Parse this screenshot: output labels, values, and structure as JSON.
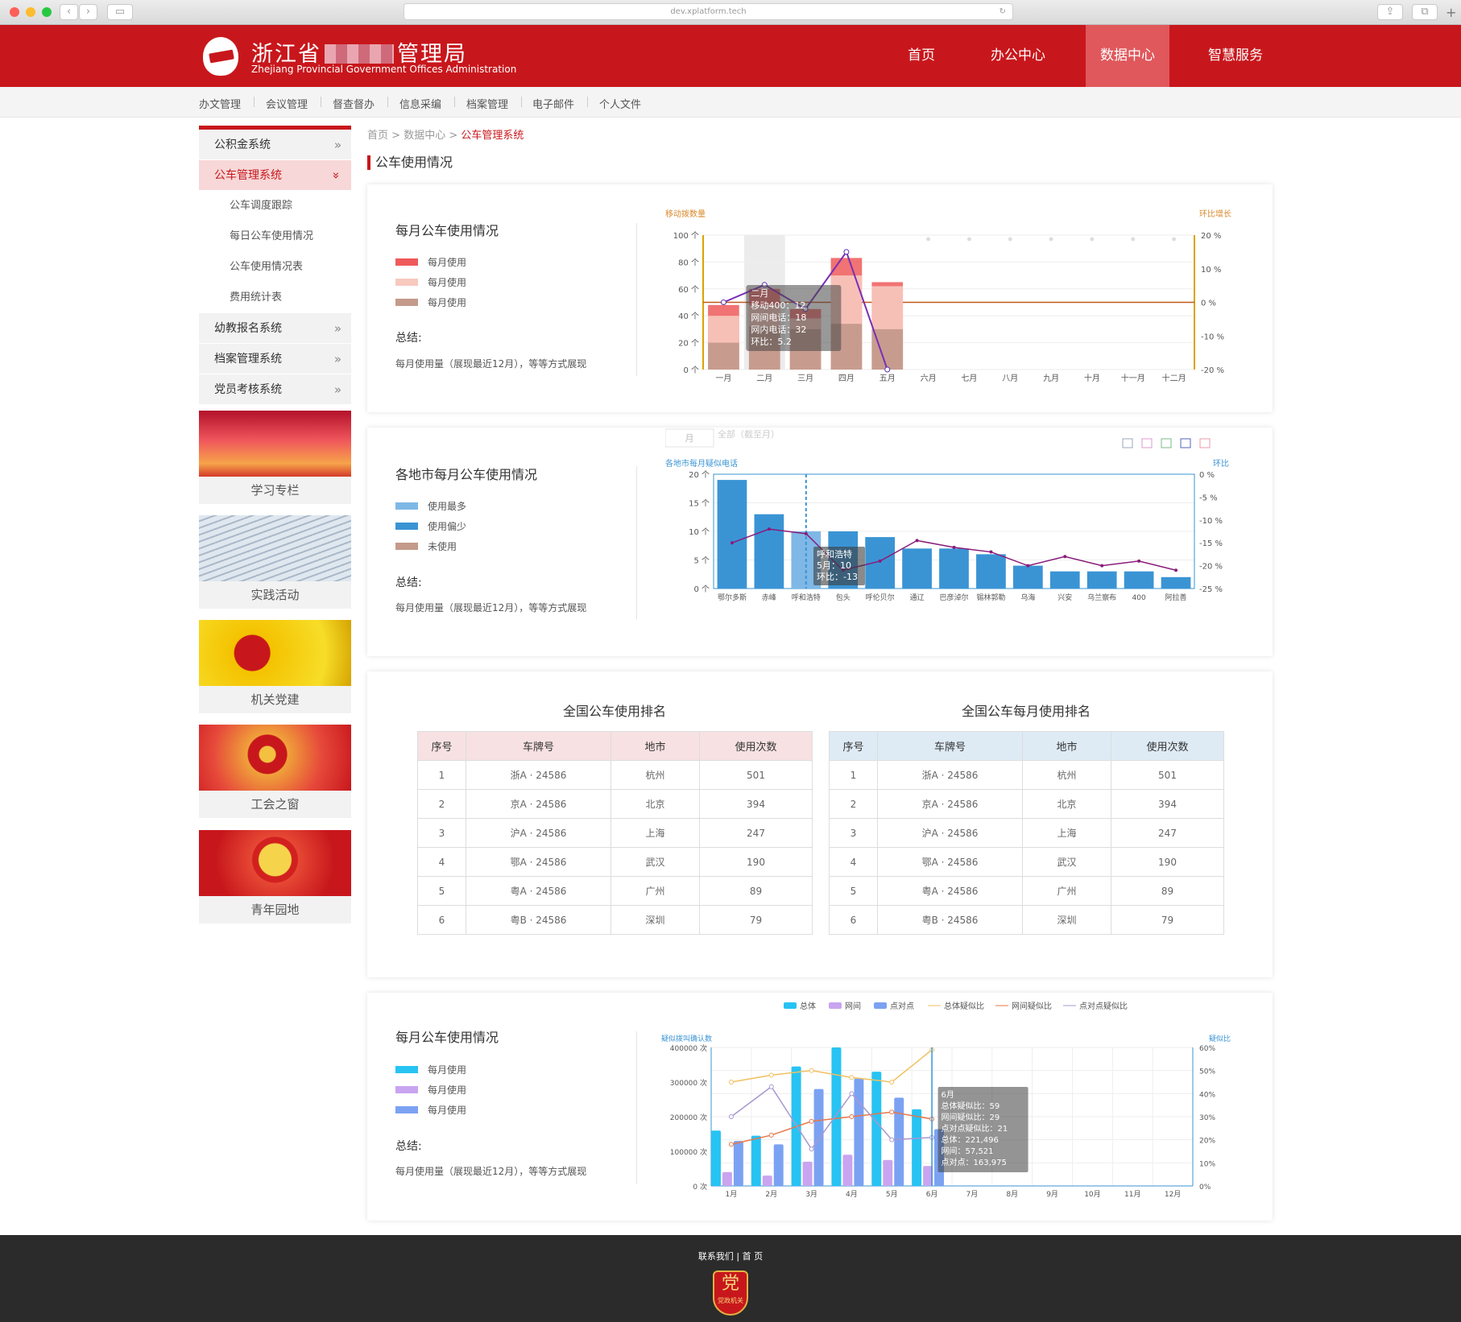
{
  "browser": {
    "url": "dev.xplatform.tech"
  },
  "header": {
    "title_visible_start": "浙江省",
    "title_visible_end": "管理局",
    "subtitle_en": "Zhejiang Provincial Government Offices Administration",
    "nav": [
      "首页",
      "办公中心",
      "数据中心",
      "智慧服务"
    ],
    "active_nav": "数据中心"
  },
  "subnav": [
    "办文管理",
    "会议管理",
    "督查督办",
    "信息采编",
    "档案管理",
    "电子邮件",
    "个人文件"
  ],
  "sidebar": {
    "items": [
      {
        "label": "公积金系统"
      },
      {
        "label": "公车管理系统",
        "active": true
      },
      {
        "label": "公车调度跟踪"
      },
      {
        "label": "每日公车使用情况"
      },
      {
        "label": "公车使用情况表"
      },
      {
        "label": "费用统计表"
      },
      {
        "label": "幼教报名系统"
      },
      {
        "label": "档案管理系统"
      },
      {
        "label": "党员考核系统"
      }
    ],
    "promos": [
      "学习专栏",
      "实践活动",
      "机关党建",
      "工会之窗",
      "青年园地"
    ]
  },
  "breadcrumb": {
    "home": "首页",
    "sep": ">",
    "center": "数据中心",
    "current": "公车管理系统"
  },
  "section_title": "公车使用情况",
  "panels": [
    {
      "title": "每月公车使用情况",
      "legend": [
        "每月使用",
        "每月使用",
        "每月使用"
      ],
      "legend_colors": [
        "#ef5a5a",
        "#f7c9bf",
        "#c49a8b"
      ],
      "summary_title": "总结:",
      "summary": "每月使用量（展现最近12月），等等方式展现"
    },
    {
      "title": "各地市每月公车使用情况",
      "legend": [
        "使用最多",
        "使用偏少",
        "未使用"
      ],
      "legend_colors": [
        "#7fb8e6",
        "#3a94d4",
        "#c49a8b"
      ],
      "summary_title": "总结:",
      "summary": "每月使用量（展现最近12月），等等方式展现"
    },
    {
      "title": "每月公车使用情况",
      "legend": [
        "每月使用",
        "每月使用",
        "每月使用"
      ],
      "legend_colors": [
        "#27c3f3",
        "#c9a4f0",
        "#7ba2f2"
      ],
      "summary_title": "总结:",
      "summary": "每月使用量（展现最近12月），等等方式展现"
    }
  ],
  "tables": {
    "left_title": "全国公车使用排名",
    "right_title": "全国公车每月使用排名",
    "headers": [
      "序号",
      "车牌号",
      "地市",
      "使用次数"
    ],
    "rows": [
      [
        "1",
        "浙A · 24586",
        "杭州",
        "501"
      ],
      [
        "2",
        "京A · 24586",
        "北京",
        "394"
      ],
      [
        "3",
        "沪A · 24586",
        "上海",
        "247"
      ],
      [
        "4",
        "鄂A · 24586",
        "武汉",
        "190"
      ],
      [
        "5",
        "粤A · 24586",
        "广州",
        "89"
      ],
      [
        "6",
        "粤B · 24586",
        "深圳",
        "79"
      ]
    ]
  },
  "chart_data": [
    {
      "type": "bar",
      "categories": [
        "一月",
        "二月",
        "三月",
        "四月",
        "五月",
        "六月",
        "七月",
        "八月",
        "九月",
        "十月",
        "十一月",
        "十二月"
      ],
      "series": [
        {
          "values": [
            48,
            60,
            45,
            83,
            65,
            null,
            null,
            null,
            null,
            null,
            null,
            null
          ]
        },
        {
          "values": [
            40,
            48,
            38,
            70,
            62,
            null,
            null,
            null,
            null,
            null,
            null,
            null
          ]
        },
        {
          "values": [
            20,
            32,
            30,
            34,
            30,
            null,
            null,
            null,
            null,
            null,
            null,
            null
          ]
        }
      ],
      "line": [
        0,
        5.2,
        -2,
        15,
        -20,
        null,
        null,
        null,
        null,
        null,
        null,
        null
      ],
      "ylabel_left": "移动拨数量",
      "ylabel_right": "环比增长",
      "yticks_left": [
        "100 个",
        "80 个",
        "60 个",
        "40 个",
        "20 个",
        "0 个"
      ],
      "yticks_right": [
        "20 %",
        "10 %",
        "0 %",
        "-10 %",
        "-20 %"
      ],
      "tooltip": [
        "二月",
        "移动400：12",
        "网间电话：18",
        "网内电话：32",
        "环比：5.2"
      ],
      "ylim_left": [
        0,
        100
      ],
      "ylim_right": [
        -20,
        20
      ]
    },
    {
      "type": "bar",
      "tabs": [
        "月",
        "全部（截至月）"
      ],
      "categories": [
        "鄂尔多斯",
        "赤峰",
        "呼和浩特",
        "包头",
        "呼伦贝尔",
        "通辽",
        "巴彦淖尔",
        "锡林郭勒",
        "乌海",
        "兴安",
        "乌兰察布",
        "400",
        "阿拉善"
      ],
      "values": [
        19,
        13,
        10,
        10,
        9,
        7,
        7,
        6,
        4,
        3,
        3,
        3,
        2
      ],
      "line": [
        -15,
        -12,
        -13,
        -21,
        -19,
        -14.5,
        -16,
        -17,
        -20,
        -18,
        -20,
        -19,
        -21
      ],
      "ylabel_left": "各地市每月疑似电话",
      "ylabel_right": "环比",
      "yticks_left": [
        "20 个",
        "15 个",
        "10 个",
        "5 个",
        "0 个"
      ],
      "yticks_right": [
        "0 %",
        "-5 %",
        "-10 %",
        "-15 %",
        "-20 %",
        "-25 %"
      ],
      "tooltip": [
        "呼和浩特",
        "5月：10",
        "环比：-13"
      ],
      "ylim_left": [
        0,
        20
      ],
      "ylim_right": [
        -25,
        0
      ]
    },
    {
      "type": "bar",
      "categories": [
        "1月",
        "2月",
        "3月",
        "4月",
        "5月",
        "6月",
        "7月",
        "8月",
        "9月",
        "10月",
        "11月",
        "12月"
      ],
      "series": [
        {
          "name": "总体",
          "values": [
            160000,
            145000,
            345000,
            400000,
            330000,
            221496,
            null,
            null,
            null,
            null,
            null,
            null
          ]
        },
        {
          "name": "网间",
          "values": [
            40000,
            30000,
            70000,
            90000,
            75000,
            57521,
            null,
            null,
            null,
            null,
            null,
            null
          ]
        },
        {
          "name": "点对点",
          "values": [
            130000,
            120000,
            280000,
            310000,
            255000,
            163975,
            null,
            null,
            null,
            null,
            null,
            null
          ]
        }
      ],
      "lines": [
        {
          "name": "总体疑似比",
          "values": [
            45,
            48,
            50,
            47,
            45,
            59
          ]
        },
        {
          "name": "网间疑似比",
          "values": [
            18,
            22,
            28,
            30,
            32,
            29
          ]
        },
        {
          "name": "点对点疑似比",
          "values": [
            30,
            43,
            16,
            40,
            20,
            21
          ]
        }
      ],
      "ylabel_left": "疑似拨叫确认数",
      "ylabel_right": "疑似比",
      "yticks_left": [
        "400000 次",
        "300000 次",
        "200000 次",
        "100000 次",
        "0 次"
      ],
      "yticks_right": [
        "60%",
        "50%",
        "40%",
        "30%",
        "20%",
        "10%",
        "0%"
      ],
      "tooltip": [
        "6月",
        "总体疑似比：59",
        "网间疑似比：29",
        "点对点疑似比：21",
        "总体：221,496",
        "网间：57,521",
        "点对点：163,975"
      ],
      "ylim_left": [
        0,
        400000
      ],
      "ylim_right": [
        0,
        60
      ]
    }
  ],
  "footer": {
    "links": "联系我们 | 首 页",
    "badge_char": "党",
    "badge_text": "党政机关"
  }
}
